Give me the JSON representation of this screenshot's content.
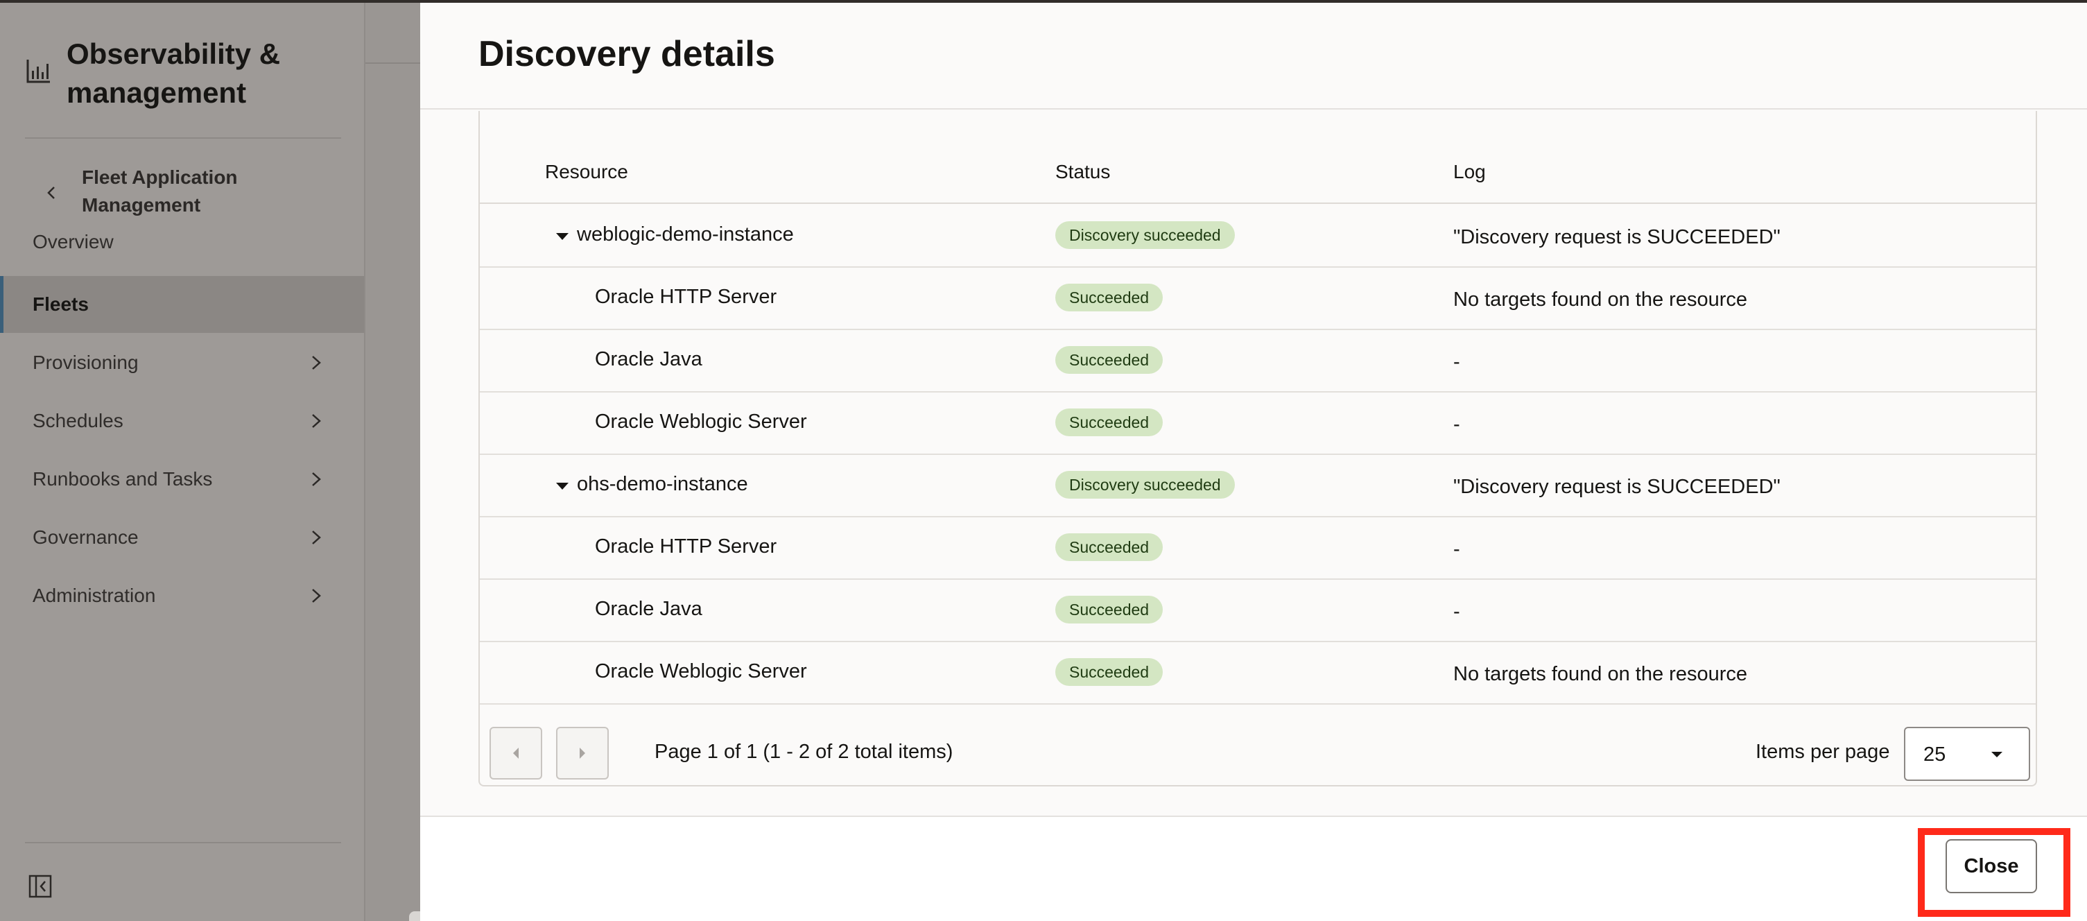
{
  "sidebar": {
    "title": "Observability & management",
    "back_label": "Fleet Application Management",
    "items": [
      {
        "label": "Overview",
        "active": false,
        "has_submenu": false
      },
      {
        "label": "Fleets",
        "active": true,
        "has_submenu": false
      },
      {
        "label": "Provisioning",
        "active": false,
        "has_submenu": true
      },
      {
        "label": "Schedules",
        "active": false,
        "has_submenu": true
      },
      {
        "label": "Runbooks and Tasks",
        "active": false,
        "has_submenu": true
      },
      {
        "label": "Governance",
        "active": false,
        "has_submenu": true
      },
      {
        "label": "Administration",
        "active": false,
        "has_submenu": true
      }
    ]
  },
  "panel": {
    "title": "Discovery details",
    "table": {
      "columns": [
        "Resource",
        "Status",
        "Log"
      ],
      "rows": [
        {
          "resource": "weblogic-demo-instance",
          "level": 0,
          "expanded": true,
          "status": "Discovery succeeded",
          "log": "\"Discovery request is SUCCEEDED\""
        },
        {
          "resource": "Oracle HTTP Server",
          "level": 1,
          "status": "Succeeded",
          "log": "No targets found on the resource"
        },
        {
          "resource": "Oracle Java",
          "level": 1,
          "status": "Succeeded",
          "log": "-"
        },
        {
          "resource": "Oracle Weblogic Server",
          "level": 1,
          "status": "Succeeded",
          "log": "-"
        },
        {
          "resource": "ohs-demo-instance",
          "level": 0,
          "expanded": true,
          "status": "Discovery succeeded",
          "log": "\"Discovery request is SUCCEEDED\""
        },
        {
          "resource": "Oracle HTTP Server",
          "level": 1,
          "status": "Succeeded",
          "log": "-"
        },
        {
          "resource": "Oracle Java",
          "level": 1,
          "status": "Succeeded",
          "log": "-"
        },
        {
          "resource": "Oracle Weblogic Server",
          "level": 1,
          "status": "Succeeded",
          "log": "No targets found on the resource"
        }
      ]
    },
    "pagination": {
      "page_text": "Page 1 of 1 (1 - 2 of 2 total items)",
      "items_per_page_label": "Items per page",
      "items_per_page": "25"
    },
    "footer": {
      "close_label": "Close"
    }
  },
  "colors": {
    "badge_bg": "#d4e6c3",
    "highlight": "#ff2a1a",
    "sidebar_bg": "#9e9a97"
  }
}
